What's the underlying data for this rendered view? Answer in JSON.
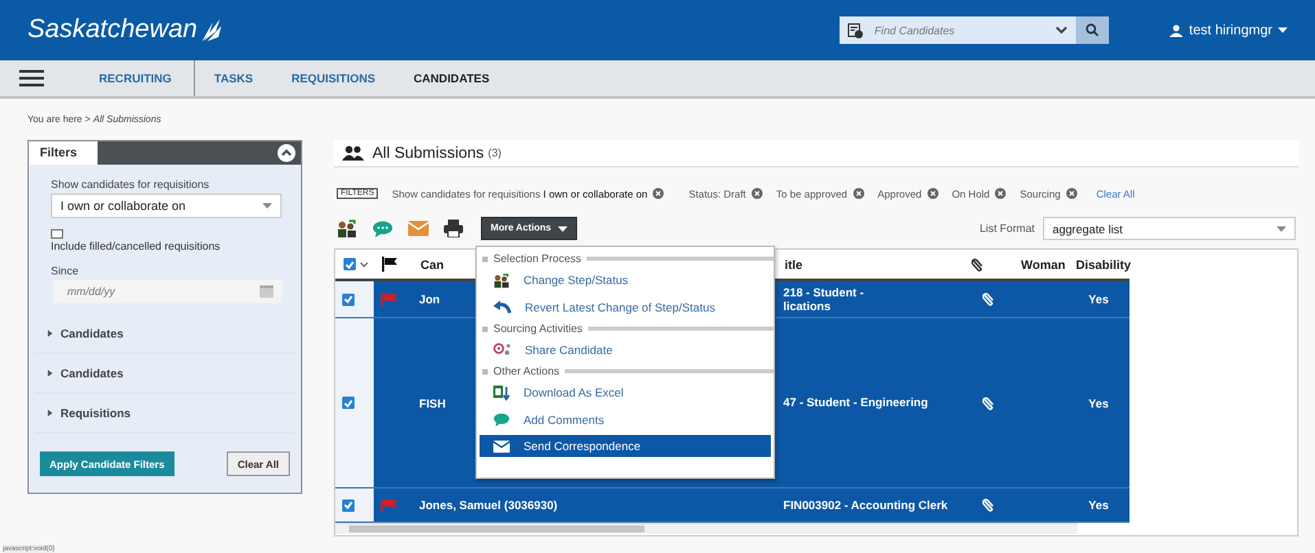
{
  "header": {
    "logo": "Saskatchewan",
    "search": {
      "placeholder": "Find Candidates"
    },
    "user": "test hiringmgr"
  },
  "nav": {
    "tabs": [
      {
        "label": "RECRUITING",
        "selected": false
      },
      {
        "label": "TASKS",
        "selected": false
      },
      {
        "label": "REQUISITIONS",
        "selected": false
      },
      {
        "label": "CANDIDATES",
        "selected": true
      }
    ]
  },
  "breadcrumb": {
    "prefix": "You are here >",
    "current": "All Submissions"
  },
  "filters_panel": {
    "title": "Filters",
    "expanded": true,
    "requisitions_label": "Show candidates for requisitions",
    "requisitions_value": "I own or collaborate on",
    "include_filled": {
      "label": "Include filled/cancelled requisitions",
      "checked": false
    },
    "since": {
      "label": "Since",
      "placeholder": "mm/dd/yy"
    },
    "sections": [
      {
        "label": "Candidates",
        "expanded": false
      },
      {
        "label": "Candidates",
        "expanded": false
      },
      {
        "label": "Requisitions",
        "expanded": false
      }
    ],
    "apply_button": "Apply Candidate Filters",
    "clear_button": "Clear All"
  },
  "list": {
    "title": "All Submissions",
    "count": "(3)",
    "filters_tag": "FILTERS",
    "applied_filters": [
      {
        "text": "Show candidates for requisitions **I own or collaborate on**"
      },
      {
        "text": "Status: Draft"
      },
      {
        "text": "To be approved"
      },
      {
        "text": "Approved"
      },
      {
        "text": "On Hold"
      },
      {
        "text": "Sourcing"
      }
    ],
    "clear_all": "Clear All",
    "more_actions": "More Actions",
    "list_format_label": "List Format",
    "list_format_value": "aggregate list",
    "select_all_checked": true,
    "columns": [
      {
        "kind": "select"
      },
      {
        "kind": "flag"
      },
      {
        "kind": "text",
        "label": "Can"
      },
      {
        "kind": "text",
        "label": "itle"
      },
      {
        "kind": "attachment"
      },
      {
        "kind": "text",
        "label": "Woman"
      },
      {
        "kind": "text",
        "label": "Disability"
      }
    ],
    "rows": [
      {
        "selected": true,
        "checked": true,
        "flagged": true,
        "candidate": "Jon",
        "title_lines": [
          "218 - Student -",
          "lications"
        ],
        "attachment": true,
        "disability": "Yes"
      },
      {
        "selected": true,
        "checked": true,
        "flagged": false,
        "candidate": "FISH",
        "title_lines": [
          "47 - Student - Engineering"
        ],
        "attachment": true,
        "disability": "Yes"
      },
      {
        "selected": true,
        "checked": true,
        "flagged": true,
        "candidate": "Jones, Samuel (3036930)",
        "title_lines": [
          "FIN003902 - Accounting Clerk"
        ],
        "attachment": true,
        "disability": "Yes"
      }
    ]
  },
  "menu": {
    "groups": [
      {
        "heading": "Selection Process",
        "items": [
          {
            "label": "Change Step/Status",
            "kind": "step",
            "selected": false
          },
          {
            "label": "Revert Latest Change of Step/Status",
            "kind": "revert",
            "selected": false
          }
        ]
      },
      {
        "heading": "Sourcing Activities",
        "items": [
          {
            "label": "Share Candidate",
            "kind": "share",
            "selected": false
          }
        ]
      },
      {
        "heading": "Other Actions",
        "items": [
          {
            "label": "Download As Excel",
            "kind": "excel",
            "selected": false
          },
          {
            "label": "Add Comments",
            "kind": "comment",
            "selected": false
          },
          {
            "label": "Send Correspondence",
            "kind": "mail",
            "selected": true
          }
        ]
      }
    ]
  },
  "status_bar": "javascript:void(0)"
}
